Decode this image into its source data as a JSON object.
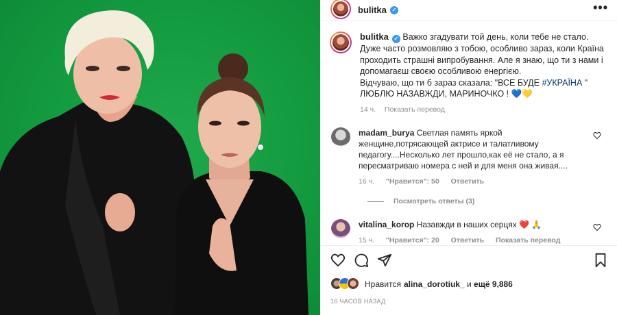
{
  "post": {
    "author": "bulitka",
    "header_more": "•••",
    "caption": {
      "text_main": "Важко згадувати той день, коли тебе не стало. Дуже часто розмовляю з тобою, особливо зараз, коли Країна проходить страшні випробування. Але я знаю, що ти з нами і допомагаєш своєю особливою енергією.",
      "text_line2_start": "Відчуваю, що ти б зараз сказала: \"ВСЕ БУДЕ ",
      "hashtag": "#УКРАЇНА",
      "text_line2_end": " \"",
      "text_line3": "ЛЮБЛЮ НАЗАВЖДИ, МАРИНОЧКО ! 💙💛",
      "time": "14 ч.",
      "translate": "Показать перевод"
    },
    "comments": [
      {
        "username": "madam_burya",
        "text": "Светлая память яркой женщине,потрясающей актрисе и талатливому педагогу....Несколько лет прошло,как её не стало, а я пересматриваю номера с ней и для меня она живая....",
        "time": "16 ч.",
        "likes": "\"Нравится\": 50",
        "reply": "Ответить",
        "icon": "heart-outline-icon"
      },
      {
        "username": "vitalina_korop",
        "text": "Назавжди в наших серцях ❤️ 🙏",
        "time": "15 ч.",
        "likes": "\"Нравится\": 20",
        "reply": "Ответить",
        "translate": "Показать перевод",
        "icon": "heart-outline-icon"
      }
    ],
    "view_replies": "Посмотреть ответы (3)",
    "likes": {
      "prefix": "Нравится",
      "user": "alina_dorotiuk_",
      "middle": " и ",
      "count": "ещё 9,886"
    },
    "date": "16 ЧАСОВ НАЗАД"
  },
  "colors": {
    "green_screen": "#139a3f",
    "verified": "#3897f0",
    "hashtag": "#00376b",
    "muted": "#8e8e8e"
  },
  "icons": [
    "heart-icon",
    "comment-icon",
    "share-icon",
    "bookmark-icon",
    "verified-icon",
    "more-icon"
  ]
}
